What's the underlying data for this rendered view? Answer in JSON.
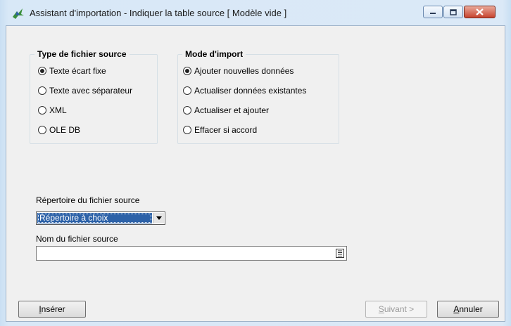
{
  "window": {
    "title": "Assistant d'importation - Indiquer la table source [ Modèle vide ]",
    "controls": [
      "minimize-icon",
      "maximize-icon",
      "close-icon"
    ]
  },
  "source_type": {
    "title": "Type de fichier source",
    "options": [
      {
        "label": "Texte écart fixe",
        "selected": true
      },
      {
        "label": "Texte avec séparateur",
        "selected": false
      },
      {
        "label": "XML",
        "selected": false
      },
      {
        "label": "OLE DB",
        "selected": false
      }
    ]
  },
  "import_mode": {
    "title": "Mode d'import",
    "options": [
      {
        "label": "Ajouter nouvelles données",
        "selected": true
      },
      {
        "label": "Actualiser données existantes",
        "selected": false
      },
      {
        "label": "Actualiser et ajouter",
        "selected": false
      },
      {
        "label": "Effacer si accord",
        "selected": false
      }
    ]
  },
  "directory": {
    "label": "Répertoire du fichier source",
    "value": "Répertoire à choix"
  },
  "filename": {
    "label": "Nom du fichier source",
    "value": ""
  },
  "buttons": {
    "insert": {
      "mnemonic": "I",
      "rest": "nsérer"
    },
    "next": {
      "mnemonic": "S",
      "rest": "uivant >"
    },
    "cancel": {
      "mnemonic": "A",
      "rest": "nnuler"
    }
  },
  "colors": {
    "selection": "#2d62a8",
    "close_button": "#c7432e"
  }
}
